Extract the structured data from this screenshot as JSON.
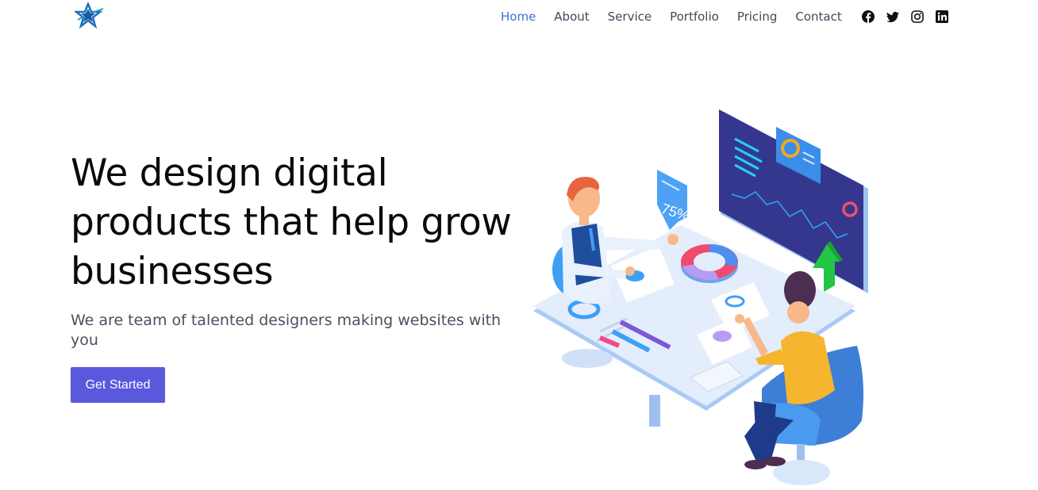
{
  "brand": {
    "logo_icon": "star-logo-icon"
  },
  "nav": {
    "items": [
      {
        "label": "Home",
        "active": true
      },
      {
        "label": "About",
        "active": false
      },
      {
        "label": "Service",
        "active": false
      },
      {
        "label": "Portfolio",
        "active": false
      },
      {
        "label": "Pricing",
        "active": false
      },
      {
        "label": "Contact",
        "active": false
      }
    ],
    "social": [
      "facebook-icon",
      "twitter-icon",
      "instagram-icon",
      "linkedin-icon"
    ],
    "active_color": "#3e6fd8"
  },
  "hero": {
    "title": "We design digital products that help grow businesses",
    "subtitle": "We are team of talented designers making websites with you",
    "cta_label": "Get Started",
    "cta_color": "#5a58dc"
  },
  "illustration": {
    "badge_text": "75%"
  }
}
